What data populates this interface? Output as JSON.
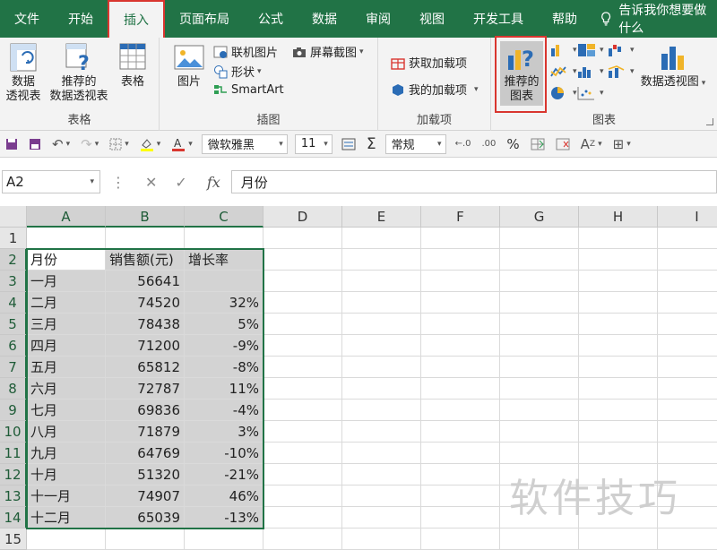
{
  "ribbon_tabs": [
    "文件",
    "开始",
    "插入",
    "页面布局",
    "公式",
    "数据",
    "审阅",
    "视图",
    "开发工具",
    "帮助"
  ],
  "tell_me": "告诉我你想要做什么",
  "groups": {
    "tables": {
      "title": "表格",
      "pivot": "数据\n透视表",
      "recommended_pivot": "推荐的\n数据透视表",
      "table": "表格"
    },
    "illustrations": {
      "title": "插图",
      "pictures": "图片",
      "online_pictures": "联机图片",
      "shapes": "形状",
      "smartart": "SmartArt",
      "screenshot": "屏幕截图"
    },
    "addins": {
      "title": "加载项",
      "get_addins": "获取加载项",
      "my_addins": "我的加载项"
    },
    "charts": {
      "title": "图表",
      "recommended": "推荐的\n图表",
      "pivot_chart": "数据透视图"
    }
  },
  "toolbar": {
    "font": "微软雅黑",
    "size": "11",
    "format": "常规",
    "sigma": "Σ",
    "percent": "%"
  },
  "formula_bar": {
    "name_box": "A2",
    "fx": "fx",
    "content": "月份"
  },
  "columns": [
    "A",
    "B",
    "C",
    "D",
    "E",
    "F",
    "G",
    "H",
    "I"
  ],
  "rows": [
    "1",
    "2",
    "3",
    "4",
    "5",
    "6",
    "7",
    "8",
    "9",
    "10",
    "11",
    "12",
    "13",
    "14",
    "15"
  ],
  "table": {
    "headers": [
      "月份",
      "销售额(元)",
      "增长率"
    ],
    "data": [
      [
        "一月",
        "56641",
        ""
      ],
      [
        "二月",
        "74520",
        "32%"
      ],
      [
        "三月",
        "78438",
        "5%"
      ],
      [
        "四月",
        "71200",
        "-9%"
      ],
      [
        "五月",
        "65812",
        "-8%"
      ],
      [
        "六月",
        "72787",
        "11%"
      ],
      [
        "七月",
        "69836",
        "-4%"
      ],
      [
        "八月",
        "71879",
        "3%"
      ],
      [
        "九月",
        "64769",
        "-10%"
      ],
      [
        "十月",
        "51320",
        "-21%"
      ],
      [
        "十一月",
        "74907",
        "46%"
      ],
      [
        "十二月",
        "65039",
        "-13%"
      ]
    ]
  },
  "watermark": "软件技巧",
  "colors": {
    "excel_green": "#217346",
    "highlight_red": "#d9362f"
  }
}
